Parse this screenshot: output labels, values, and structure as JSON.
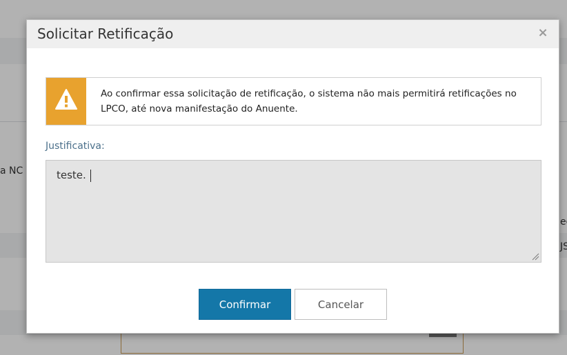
{
  "background": {
    "left_text": "a NC",
    "right_text_1": "eg",
    "right_text_2": "JS"
  },
  "modal": {
    "title": "Solicitar Retificação",
    "close_symbol": "×",
    "alert": {
      "icon": "warning-triangle-icon",
      "color": "#e8a22e",
      "message": "Ao confirmar essa solicitação de retificação, o sistema não mais permitirá retificações no LPCO, até nova manifestação do Anuente."
    },
    "justification": {
      "label": "Justificativa:",
      "value": "teste."
    },
    "buttons": {
      "confirm_label": "Confirmar",
      "cancel_label": "Cancelar"
    }
  },
  "colors": {
    "primary": "#1477a8",
    "warning": "#e8a22e"
  }
}
